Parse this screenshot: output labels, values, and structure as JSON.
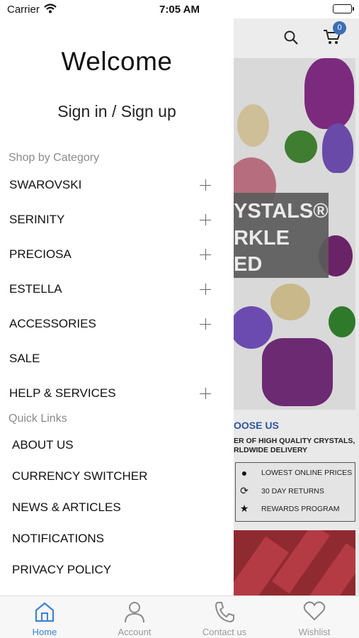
{
  "status_bar": {
    "carrier": "Carrier",
    "time": "7:05 AM"
  },
  "drawer": {
    "welcome": "Welcome",
    "sign_in": "Sign in / Sign up",
    "shop_by_category_label": "Shop by Category",
    "categories": [
      {
        "label": "SWAROVSKI",
        "expandable": true
      },
      {
        "label": "SERINITY",
        "expandable": true
      },
      {
        "label": "PRECIOSA",
        "expandable": true
      },
      {
        "label": "ESTELLA",
        "expandable": true
      },
      {
        "label": "ACCESSORIES",
        "expandable": true
      },
      {
        "label": "SALE",
        "expandable": false
      },
      {
        "label": "HELP & SERVICES",
        "expandable": true
      }
    ],
    "quick_links_label": "Quick Links",
    "quick_links": [
      "ABOUT US",
      "CURRENCY SWITCHER",
      "NEWS & ARTICLES",
      "NOTIFICATIONS",
      "PRIVACY POLICY"
    ]
  },
  "background_page": {
    "cart_count": "0",
    "hero_lines": [
      "YSTALS®",
      "RKLE",
      "ED"
    ],
    "why_heading": "OOSE US",
    "why_sub": [
      "ER OF HIGH QUALITY CRYSTALS,",
      "RLDWIDE DELIVERY"
    ],
    "features": [
      {
        "icon": "piggy-bank-icon",
        "label": "LOWEST ONLINE PRICES"
      },
      {
        "icon": "refresh-icon",
        "label": "30 DAY RETURNS"
      },
      {
        "icon": "star-icon",
        "label": "REWARDS PROGRAM"
      }
    ]
  },
  "tab_bar": {
    "tabs": [
      {
        "label": "Home",
        "icon": "home-icon",
        "active": true
      },
      {
        "label": "Account",
        "icon": "person-icon",
        "active": false
      },
      {
        "label": "Contact us",
        "icon": "phone-icon",
        "active": false
      },
      {
        "label": "Wishlist",
        "icon": "heart-icon",
        "active": false
      }
    ]
  },
  "colors": {
    "accent": "#3b82d6",
    "badge": "#3c6fb6",
    "heading_blue": "#2f55a0"
  }
}
